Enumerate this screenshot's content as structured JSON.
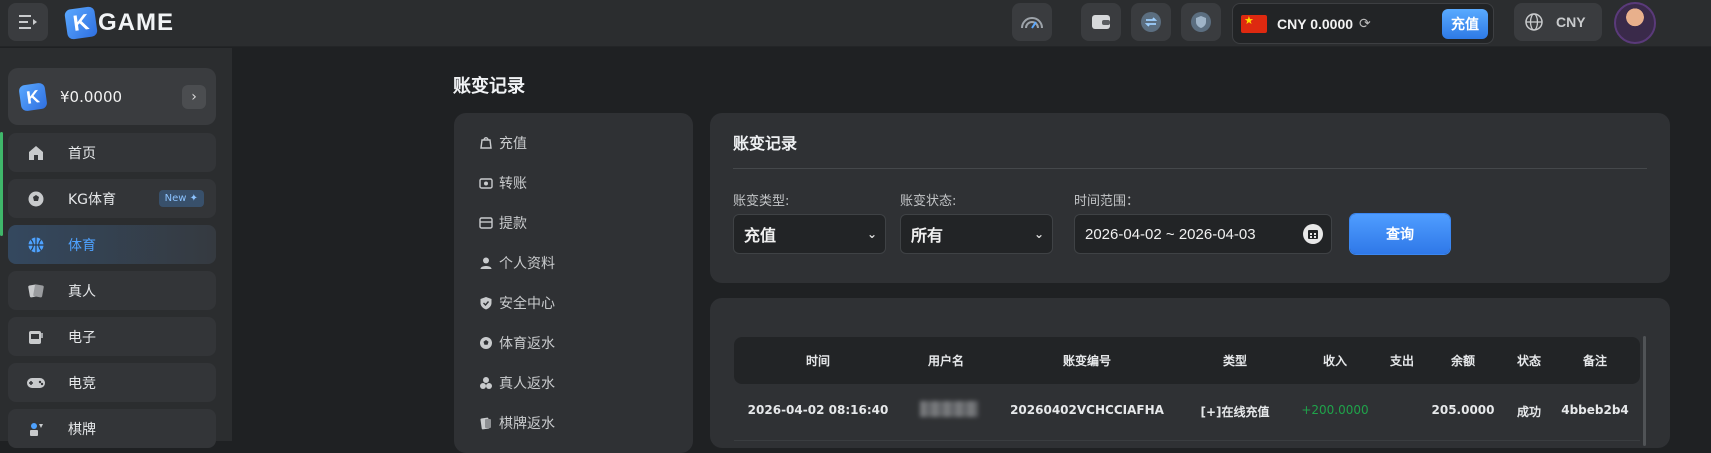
{
  "header": {
    "logo_text": "GAME",
    "logo_k": "K",
    "wallet": {
      "currency_amount": "CNY 0.0000",
      "deposit_label": "充值"
    },
    "language": {
      "label": "CNY"
    }
  },
  "sidebar": {
    "balance": "¥0.0000",
    "items": [
      {
        "label": "首页",
        "icon": "home-icon"
      },
      {
        "label": "KG体育",
        "icon": "soccer-ball-icon",
        "badge": "New"
      },
      {
        "label": "体育",
        "icon": "basketball-icon",
        "active": true
      },
      {
        "label": "真人",
        "icon": "cards-icon"
      },
      {
        "label": "电子",
        "icon": "slot-machine-icon"
      },
      {
        "label": "电竞",
        "icon": "gamepad-icon"
      },
      {
        "label": "棋牌",
        "icon": "chess-icon"
      }
    ]
  },
  "page": {
    "title": "账变记录"
  },
  "submenu": {
    "items": [
      {
        "label": "充值",
        "icon": "deposit-icon"
      },
      {
        "label": "转账",
        "icon": "transfer-icon"
      },
      {
        "label": "提款",
        "icon": "withdraw-icon"
      },
      {
        "label": "个人资料",
        "icon": "user-icon"
      },
      {
        "label": "安全中心",
        "icon": "shield-icon"
      },
      {
        "label": "体育返水",
        "icon": "soccer-icon"
      },
      {
        "label": "真人返水",
        "icon": "chips-icon"
      },
      {
        "label": "棋牌返水",
        "icon": "card-rebate-icon"
      }
    ]
  },
  "filter": {
    "title": "账变记录",
    "type_label": "账变类型:",
    "type_value": "充值",
    "status_label": "账变状态:",
    "status_value": "所有",
    "range_label": "时间范围：",
    "range_value": "2026-04-02 ~ 2026-04-03",
    "query_label": "查询"
  },
  "table": {
    "columns": [
      "时间",
      "用户名",
      "账变编号",
      "类型",
      "收入",
      "支出",
      "余额",
      "状态",
      "备注"
    ],
    "rows": [
      {
        "time": "2026-04-02 08:16:40",
        "order_no": "20260402VCHCCIAFHA",
        "type": "[+]在线充值",
        "income": "+200.0000",
        "expense": "",
        "balance": "205.0000",
        "status": "成功",
        "note": "4bbeb2b4"
      }
    ]
  },
  "colors": {
    "accent": "#2f78e8",
    "income_green": "#1fa34a",
    "active_blue": "#4ea2ff"
  }
}
